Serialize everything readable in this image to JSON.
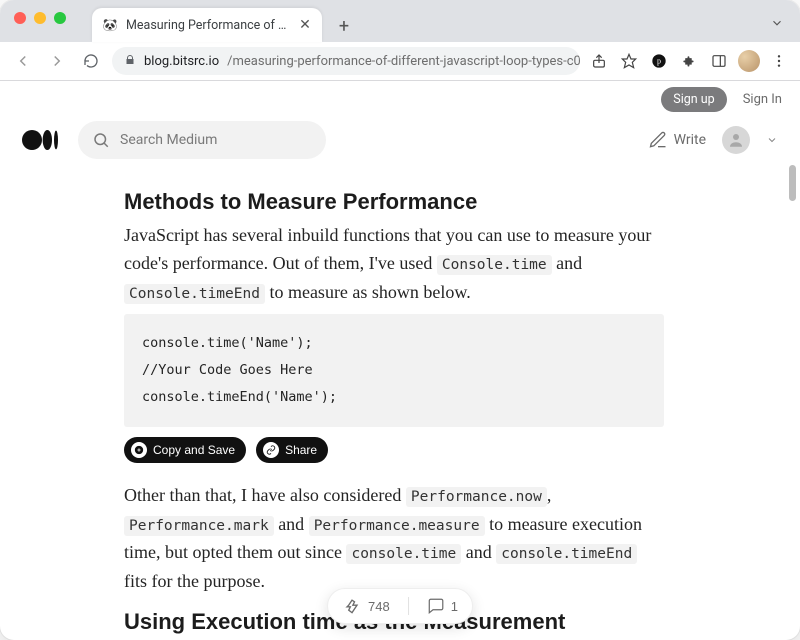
{
  "browser": {
    "tab_title": "Measuring Performance of Diff",
    "url_domain": "blog.bitsrc.io",
    "url_path": "/measuring-performance-of-different-javascript-loop-types-c0…"
  },
  "auth": {
    "signup": "Sign up",
    "signin": "Sign In"
  },
  "header": {
    "search_placeholder": "Search Medium",
    "write_label": "Write"
  },
  "article": {
    "h1": "Methods to Measure Performance",
    "p1_a": "JavaScript has several inbuild functions that you can use to measure your code's performance. Out of them, I've used ",
    "code1": "Console.time",
    "p1_b": " and ",
    "code2": "Console.timeEnd",
    "p1_c": " to measure as shown below.",
    "codeblock": "console.time('Name');\n//Your Code Goes Here\nconsole.timeEnd('Name');",
    "pills": {
      "copy": "Copy and Save",
      "share": "Share"
    },
    "p2_a": "Other than that, I have also considered ",
    "code3": "Performance.now",
    "p2_b": ", ",
    "code4": "Performance.mark",
    "p2_c": " and ",
    "code5": "Performance.measure",
    "p2_d": " to measure execution time, but opted them out since ",
    "code6": "console.time",
    "p2_e": " and ",
    "code7": "console.timeEnd",
    "p2_f": " fits for the purpose.",
    "h2": "Using Execution time as the Measurement"
  },
  "engage": {
    "claps": "748",
    "comments": "1"
  }
}
